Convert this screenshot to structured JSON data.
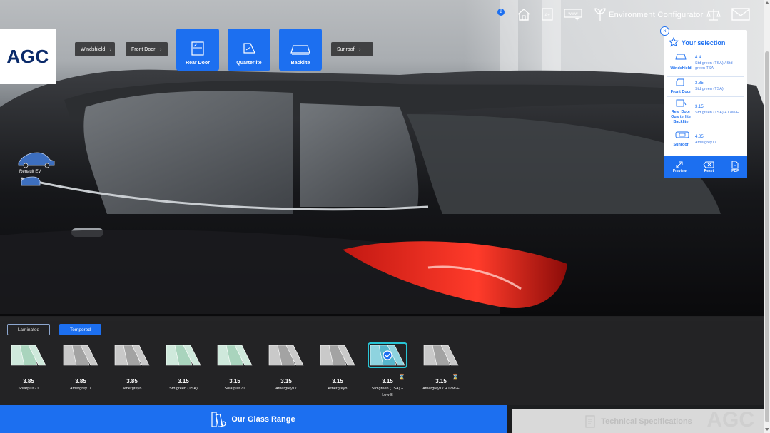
{
  "brand": {
    "logo_text": "AGC"
  },
  "part_tabs": {
    "windshield": "Windshield",
    "front_door": "Front Door",
    "rear_door": "Rear Door",
    "quarterlite": "Quarterlite",
    "backlite": "Backlite",
    "sunroof": "Sunroof"
  },
  "topnav": {
    "badge_count": "2",
    "env_configurator": "Environment Configurator",
    "www_label": "www",
    "a_label": "A+"
  },
  "model": {
    "label": "Renault EV"
  },
  "selection": {
    "title": "Your selection",
    "rows": [
      {
        "name": "Windshield",
        "value": "4.4",
        "desc": "Std green (TSA) / Std green TSA"
      },
      {
        "name": "Front Door",
        "value": "3.85",
        "desc": "Std green (TSA)"
      },
      {
        "name": "Rear Door Quarterlite Backlite",
        "value": "3.15",
        "desc": "Std green (TSA) + Low-E"
      },
      {
        "name": "Sunroof",
        "value": "4.85",
        "desc": "Athergrey17"
      }
    ],
    "actions": {
      "preview": "Preview",
      "reset": "Reset",
      "pdf": "PDF"
    }
  },
  "glass_types": {
    "laminated": "Laminated",
    "tempered": "Tempered"
  },
  "glass_cards": [
    {
      "value": "3.85",
      "name": "Solarplus71",
      "tint": "green"
    },
    {
      "value": "3.85",
      "name": "Athergrey17",
      "tint": "grey"
    },
    {
      "value": "3.85",
      "name": "Athergrey8",
      "tint": "grey"
    },
    {
      "value": "3.15",
      "name": "Std green (TSA)",
      "tint": "green"
    },
    {
      "value": "3.15",
      "name": "Solarplus71",
      "tint": "green"
    },
    {
      "value": "3.15",
      "name": "Athergrey17",
      "tint": "grey"
    },
    {
      "value": "3.15",
      "name": "Athergrey8",
      "tint": "grey"
    },
    {
      "value": "3.15",
      "name": "Std green (TSA) + Low-E",
      "tint": "selected"
    },
    {
      "value": "3.15",
      "name": "Athergrey17 + Low-E",
      "tint": "grey"
    }
  ],
  "bottom": {
    "glass_range": "Our Glass Range",
    "tech_specs": "Technical Specifications",
    "watermark": "AGC"
  },
  "colors": {
    "accent": "#1c6ff0",
    "panel_text": "#1c6ff0",
    "logo": "#0a2a6a"
  }
}
